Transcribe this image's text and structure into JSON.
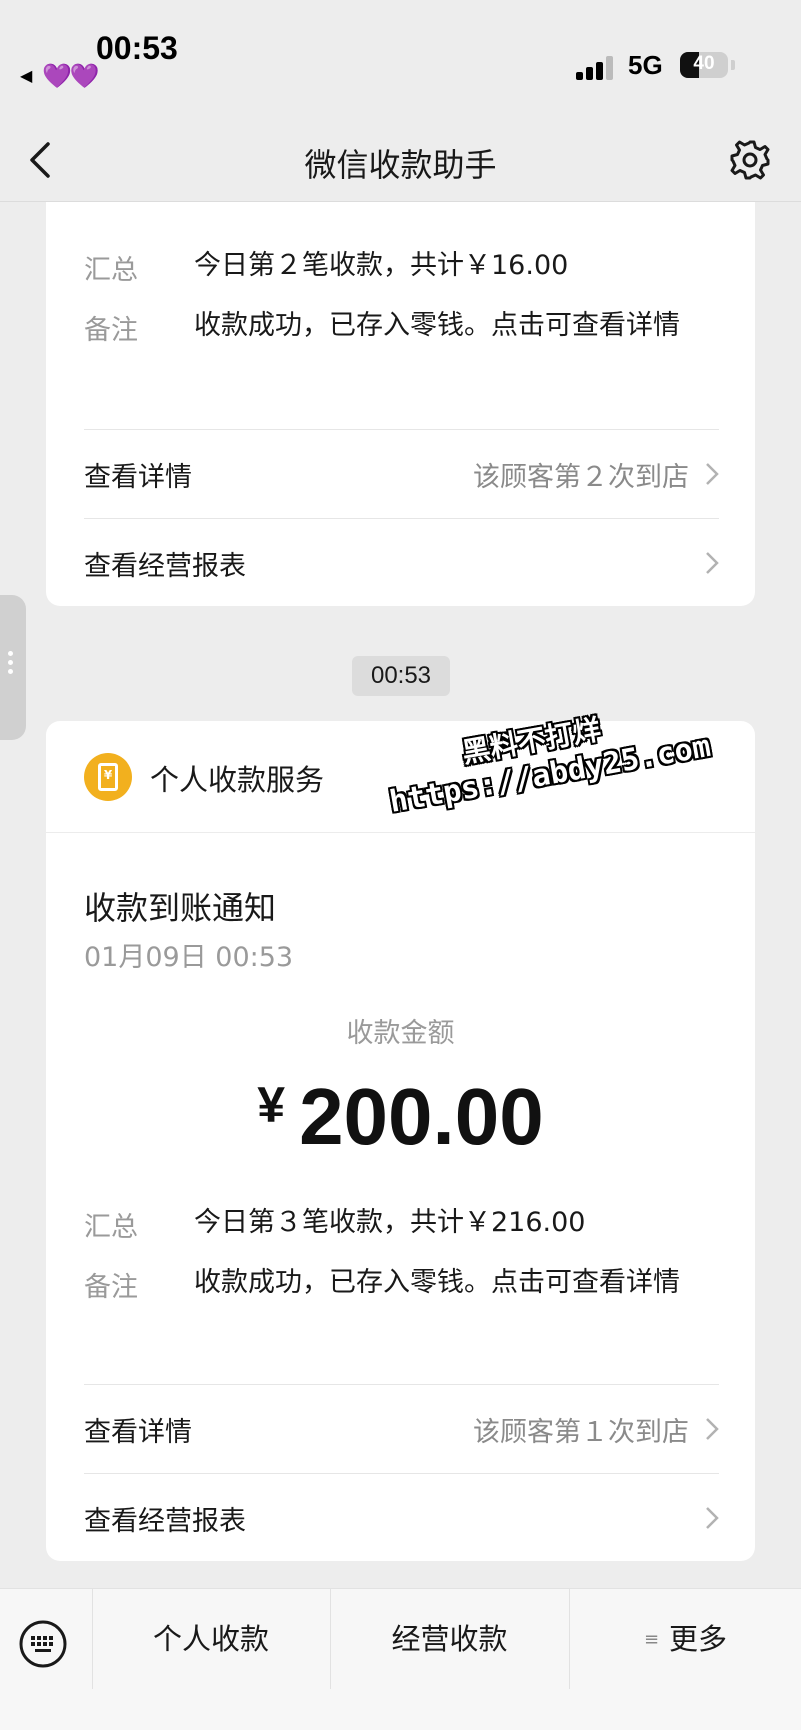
{
  "status_bar": {
    "time": "00:53",
    "back_glyph": "◀",
    "hearts": "💜💜",
    "network": "5G",
    "battery_level": 40,
    "battery_text": "40"
  },
  "nav": {
    "title": "微信收款助手",
    "back_icon": "chevron-left-icon",
    "settings_icon": "gear-icon"
  },
  "card1": {
    "summary_label": "汇总",
    "summary_value": "今日第２笔收款，共计￥16.00",
    "note_label": "备注",
    "note_value": "收款成功，已存入零钱。点击可查看详情",
    "details_label": "查看详情",
    "details_sub": "该顾客第２次到店",
    "report_label": "查看经营报表"
  },
  "timestamp": "00:53",
  "card2": {
    "service_name": "个人收款服务",
    "service_icon_glyph": "¥",
    "notice_title": "收款到账通知",
    "notice_date": "01月09日 00:53",
    "amount_label": "收款金额",
    "amount_currency": "¥",
    "amount_value": "200.00",
    "summary_label": "汇总",
    "summary_value": "今日第３笔收款，共计￥216.00",
    "note_label": "备注",
    "note_value": "收款成功，已存入零钱。点击可查看详情",
    "details_label": "查看详情",
    "details_sub": "该顾客第１次到店",
    "report_label": "查看经营报表"
  },
  "watermark": {
    "line1": "黑料不打烊",
    "line2": "https://abdy25.com"
  },
  "bottom_bar": {
    "keyboard_icon": "keyboard-icon",
    "tab1": "个人收款",
    "tab2": "经营收款",
    "tab3": "更多",
    "tab3_mark": "≡"
  },
  "colors": {
    "background": "#ededed",
    "card": "#ffffff",
    "service_icon": "#f2b01e",
    "secondary_text": "#9a9a9a"
  }
}
